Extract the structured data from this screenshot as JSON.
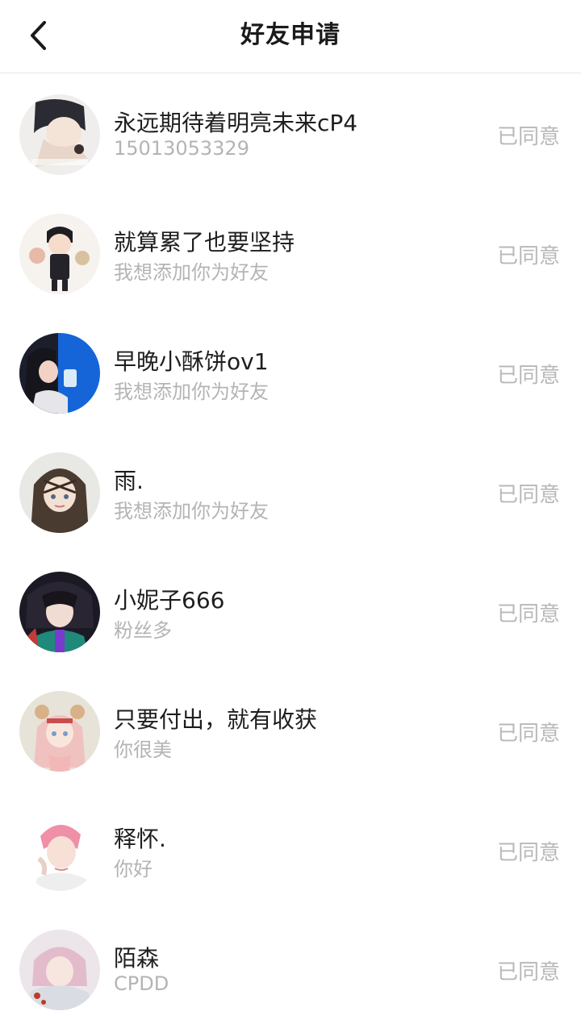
{
  "header": {
    "title": "好友申请",
    "back_icon": "chevron-left-icon"
  },
  "requests": [
    {
      "name": "永远期待着明亮未来cP4",
      "message": "15013053329",
      "status": "已同意"
    },
    {
      "name": "就算累了也要坚持",
      "message": "我想添加你为好友",
      "status": "已同意"
    },
    {
      "name": "早晚小酥饼ov1",
      "message": "我想添加你为好友",
      "status": "已同意"
    },
    {
      "name": "雨.",
      "message": "我想添加你为好友",
      "status": "已同意"
    },
    {
      "name": "小妮子666",
      "message": "粉丝多",
      "status": "已同意"
    },
    {
      "name": "只要付出，就有收获",
      "message": "你很美",
      "status": "已同意"
    },
    {
      "name": "释怀.",
      "message": "你好",
      "status": "已同意"
    },
    {
      "name": "陌森",
      "message": "CPDD",
      "status": "已同意"
    }
  ],
  "colors": {
    "title": "#1a1a1a",
    "name": "#1e1e1e",
    "secondary": "#b4b4b4",
    "divider": "#e8e8e8"
  }
}
